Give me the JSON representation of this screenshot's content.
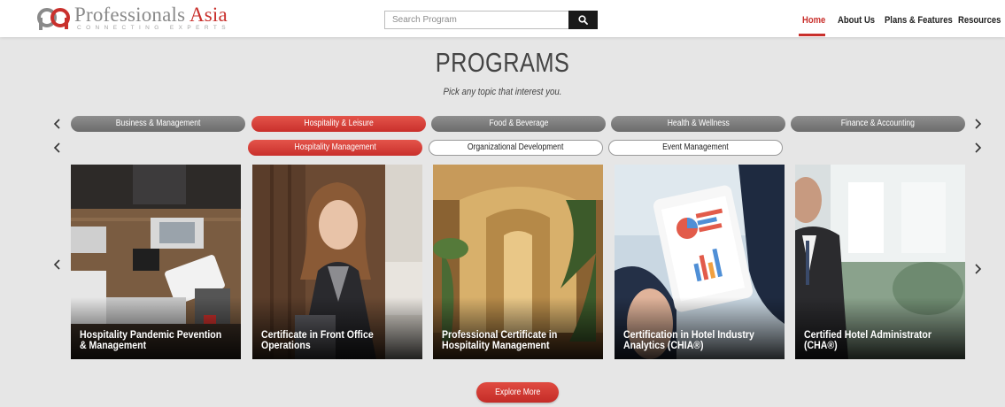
{
  "brand": {
    "name_main": "Professionals ",
    "name_accent": "Asia",
    "tagline": "CONNECTING EXPERTS",
    "accent_color": "#c9302c"
  },
  "search": {
    "placeholder": "Search Program",
    "icon": "search-icon"
  },
  "nav": {
    "items": [
      {
        "label": "Home",
        "active": true
      },
      {
        "label": "About Us",
        "active": false
      },
      {
        "label": "Plans & Features",
        "active": false
      },
      {
        "label": "Resources",
        "active": false
      }
    ]
  },
  "main": {
    "title": "PROGRAMS",
    "subtitle": "Pick any topic that interest you."
  },
  "categories": [
    {
      "label": "Business & Management",
      "selected": false
    },
    {
      "label": "Hospitality & Leisure",
      "selected": true
    },
    {
      "label": "Food & Beverage",
      "selected": false
    },
    {
      "label": "Health & Wellness",
      "selected": false
    },
    {
      "label": "Finance & Accounting",
      "selected": false
    }
  ],
  "subcategories": [
    {
      "label": "Hospitality Management",
      "selected": true
    },
    {
      "label": "Organizational Development",
      "selected": false
    },
    {
      "label": "Event Management",
      "selected": false
    }
  ],
  "programs": [
    {
      "line1": "Hospitality Pandemic Pevention",
      "line2": "& Management"
    },
    {
      "line1": "Certificate in Front Office",
      "line2": "Operations"
    },
    {
      "line1": "Professional Certificate in",
      "line2": "Hospitality Management"
    },
    {
      "line1": "Certification in Hotel Industry",
      "line2": "Analytics (CHIA®)"
    },
    {
      "line1": "Certified Hotel Administrator",
      "line2": "(CHA®)"
    }
  ],
  "explore_label": "Explore More",
  "icons": {
    "prev": "chevron-left-icon",
    "next": "chevron-right-icon"
  }
}
